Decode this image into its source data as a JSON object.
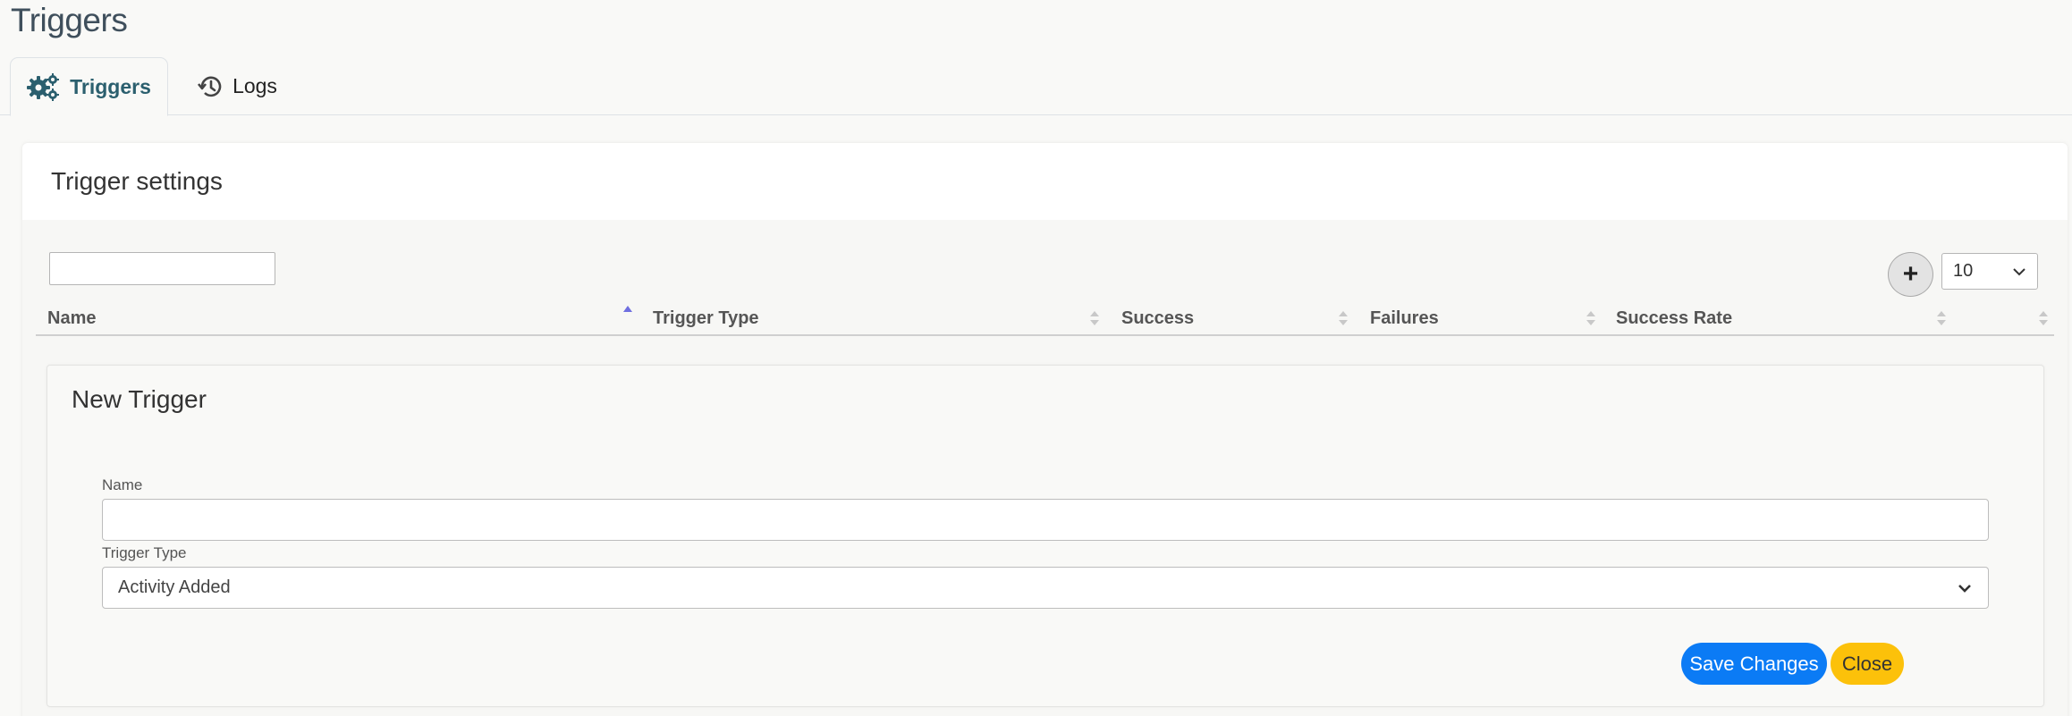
{
  "page": {
    "title": "Triggers"
  },
  "tabs": [
    {
      "label": "Triggers",
      "icon": "gears-icon",
      "active": true
    },
    {
      "label": "Logs",
      "icon": "history-icon",
      "active": false
    }
  ],
  "card": {
    "title": "Trigger settings",
    "search": {
      "value": "",
      "placeholder": ""
    },
    "add_button_label": "+",
    "page_size": {
      "selected": "10"
    }
  },
  "table": {
    "columns": [
      "Name",
      "Trigger Type",
      "Success",
      "Failures",
      "Success Rate",
      ""
    ],
    "sorted_column": "Name",
    "sort_direction": "asc",
    "sort_active_color": "#6f6fe0",
    "sort_inactive_color": "#c8c8c8"
  },
  "new_trigger": {
    "title": "New Trigger",
    "name_label": "Name",
    "name_value": "",
    "type_label": "Trigger Type",
    "type_selected": "Activity Added",
    "save_label": "Save Changes",
    "close_label": "Close"
  },
  "colors": {
    "primary": "#0b7bf5",
    "warning": "#fcc10a",
    "tab_active_text": "#2b5f6e"
  }
}
